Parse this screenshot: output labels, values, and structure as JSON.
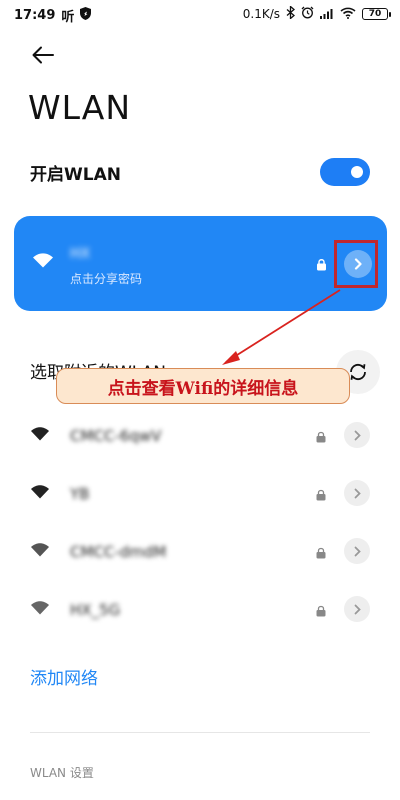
{
  "status_bar": {
    "time": "17:49",
    "carrier_badge": "听",
    "net_speed": "0.1K/s",
    "battery": "70",
    "icons": [
      "shield-icon",
      "bluetooth-icon",
      "alarm-icon",
      "signal-icon",
      "wifi-icon",
      "battery-icon"
    ]
  },
  "header": {
    "back_icon": "arrow-left-icon",
    "title": "WLAN"
  },
  "toggle": {
    "label": "开启WLAN",
    "state": "on",
    "color": "#1e7ef5"
  },
  "connected": {
    "name": "HX",
    "subtitle": "点击分享密码",
    "bg_color": "#2187f5",
    "icons": [
      "wifi-icon",
      "lock-icon",
      "chevron-right-icon"
    ]
  },
  "nearby": {
    "title": "选取附近的WLAN",
    "refresh_icon": "refresh-icon"
  },
  "annotation": {
    "text": "点击查看Wifi的详细信息",
    "color": "#c8141c"
  },
  "networks": [
    {
      "name": "CMCC-6qwV",
      "secured": true
    },
    {
      "name": "YB",
      "secured": true
    },
    {
      "name": "CMCC-dmdM",
      "secured": true
    },
    {
      "name": "HX_5G",
      "secured": true
    }
  ],
  "add_network": "添加网络",
  "settings": "WLAN 设置"
}
